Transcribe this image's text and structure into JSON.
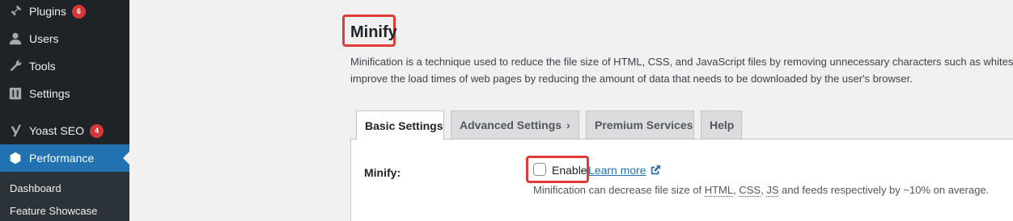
{
  "sidebar": {
    "items": [
      {
        "label": "Plugins",
        "icon": "plugin-icon",
        "badge": "6"
      },
      {
        "label": "Users",
        "icon": "users-icon"
      },
      {
        "label": "Tools",
        "icon": "wrench-icon"
      },
      {
        "label": "Settings",
        "icon": "settings-icon"
      },
      {
        "label": "Yoast SEO",
        "icon": "yoast-icon",
        "badge": "4"
      },
      {
        "label": "Performance",
        "icon": "performance-icon",
        "active": true
      }
    ],
    "submenu": [
      "Dashboard",
      "Feature Showcase"
    ]
  },
  "main": {
    "title": "Minify",
    "description_line1": "Minification is a technique used to reduce the file size of HTML, CSS, and JavaScript files by removing unnecessary characters such as whitespac",
    "description_line2": "improve the load times of web pages by reducing the amount of data that needs to be downloaded by the user's browser.",
    "tabs": [
      {
        "label": "Basic Settings",
        "active": true
      },
      {
        "label": "Advanced Settings",
        "chevron": "›"
      },
      {
        "label": "Premium Services"
      },
      {
        "label": "Help"
      }
    ],
    "setting": {
      "label": "Minify:",
      "checkbox_label": "Enable",
      "checked": false,
      "learn_more": "Learn more",
      "help_prefix": "Minification can decrease file size of ",
      "help_html": "HTML",
      "help_sep1": ", ",
      "help_css": "CSS",
      "help_sep2": ", ",
      "help_js": "JS",
      "help_suffix": " and feeds respectively by ~10% on average."
    }
  },
  "colors": {
    "sidebar_bg": "#1d2327",
    "active_bg": "#2271b1",
    "badge": "#d63638",
    "highlight": "#e03a3a",
    "link": "#2271b1"
  }
}
